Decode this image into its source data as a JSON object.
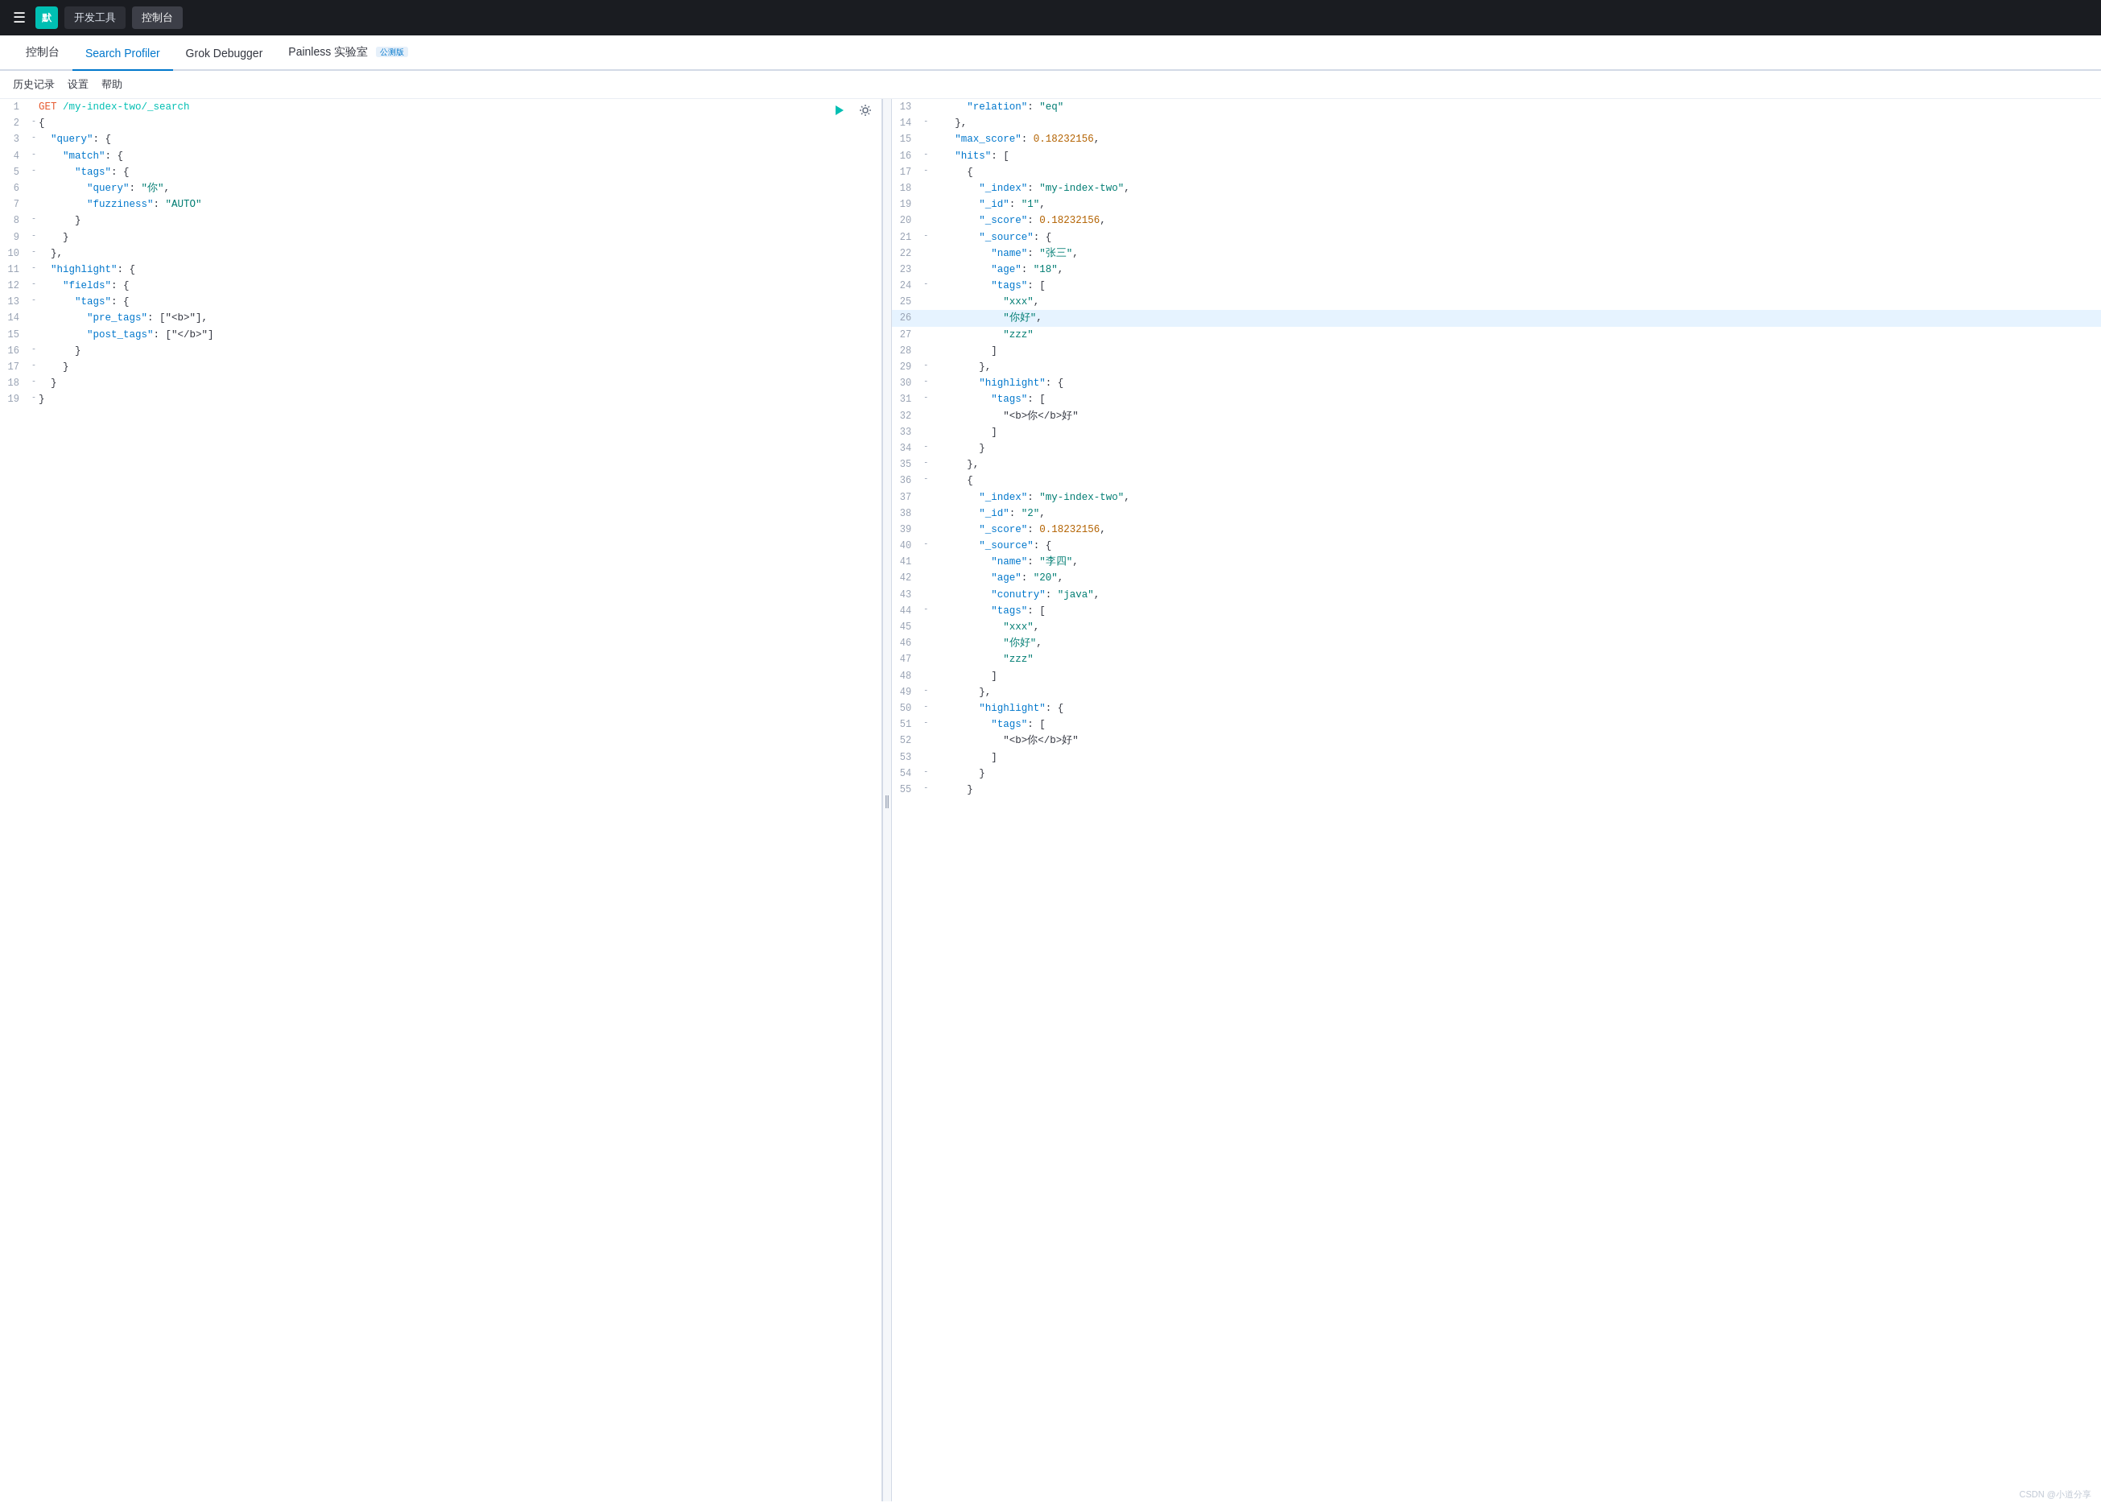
{
  "topbar": {
    "menu_icon": "☰",
    "avatar_label": "默",
    "btn_devtools": "开发工具",
    "btn_console": "控制台"
  },
  "main_nav": {
    "tabs": [
      {
        "id": "console",
        "label": "控制台",
        "active": false
      },
      {
        "id": "search-profiler",
        "label": "Search Profiler",
        "active": true
      },
      {
        "id": "grok-debugger",
        "label": "Grok Debugger",
        "active": false
      },
      {
        "id": "painless-lab",
        "label": "Painless 实验室",
        "active": false,
        "badge": "公测版"
      }
    ]
  },
  "sub_nav": {
    "items": [
      "历史记录",
      "设置",
      "帮助"
    ]
  },
  "editor": {
    "lines": [
      {
        "num": 1,
        "fold": "",
        "content": "GET /my-index-two/_search",
        "highlight": false,
        "type": "method_path"
      },
      {
        "num": 2,
        "fold": "-",
        "content": "{",
        "highlight": false
      },
      {
        "num": 3,
        "fold": "-",
        "content": "  \"query\": {",
        "highlight": false
      },
      {
        "num": 4,
        "fold": "-",
        "content": "    \"match\": {",
        "highlight": false
      },
      {
        "num": 5,
        "fold": "-",
        "content": "      \"tags\": {",
        "highlight": false
      },
      {
        "num": 6,
        "fold": "",
        "content": "        \"query\": \"你\",",
        "highlight": false
      },
      {
        "num": 7,
        "fold": "",
        "content": "        \"fuzziness\": \"AUTO\"",
        "highlight": false
      },
      {
        "num": 8,
        "fold": "-",
        "content": "      }",
        "highlight": false
      },
      {
        "num": 9,
        "fold": "-",
        "content": "    }",
        "highlight": false
      },
      {
        "num": 10,
        "fold": "-",
        "content": "  },",
        "highlight": false
      },
      {
        "num": 11,
        "fold": "-",
        "content": "  \"highlight\": {",
        "highlight": false
      },
      {
        "num": 12,
        "fold": "-",
        "content": "    \"fields\": {",
        "highlight": false
      },
      {
        "num": 13,
        "fold": "-",
        "content": "      \"tags\": {",
        "highlight": false
      },
      {
        "num": 14,
        "fold": "",
        "content": "        \"pre_tags\": [\"<b>\"],",
        "highlight": false
      },
      {
        "num": 15,
        "fold": "",
        "content": "        \"post_tags\": [\"</b>\"]",
        "highlight": false
      },
      {
        "num": 16,
        "fold": "-",
        "content": "      }",
        "highlight": false
      },
      {
        "num": 17,
        "fold": "-",
        "content": "    }",
        "highlight": false
      },
      {
        "num": 18,
        "fold": "-",
        "content": "  }",
        "highlight": false
      },
      {
        "num": 19,
        "fold": "-",
        "content": "}",
        "highlight": false
      }
    ]
  },
  "results": {
    "lines": [
      {
        "num": 13,
        "fold": "",
        "content": "      \"relation\": \"eq\"",
        "highlight": false
      },
      {
        "num": 14,
        "fold": "-",
        "content": "    },",
        "highlight": false
      },
      {
        "num": 15,
        "fold": "",
        "content": "    \"max_score\": 0.18232156,",
        "highlight": false
      },
      {
        "num": 16,
        "fold": "-",
        "content": "    \"hits\": [",
        "highlight": false
      },
      {
        "num": 17,
        "fold": "-",
        "content": "      {",
        "highlight": false
      },
      {
        "num": 18,
        "fold": "",
        "content": "        \"_index\": \"my-index-two\",",
        "highlight": false
      },
      {
        "num": 19,
        "fold": "",
        "content": "        \"_id\": \"1\",",
        "highlight": false
      },
      {
        "num": 20,
        "fold": "",
        "content": "        \"_score\": 0.18232156,",
        "highlight": false
      },
      {
        "num": 21,
        "fold": "-",
        "content": "        \"_source\": {",
        "highlight": false
      },
      {
        "num": 22,
        "fold": "",
        "content": "          \"name\": \"张三\",",
        "highlight": false
      },
      {
        "num": 23,
        "fold": "",
        "content": "          \"age\": \"18\",",
        "highlight": false
      },
      {
        "num": 24,
        "fold": "-",
        "content": "          \"tags\": [",
        "highlight": false
      },
      {
        "num": 25,
        "fold": "",
        "content": "            \"xxx\",",
        "highlight": false
      },
      {
        "num": 26,
        "fold": "",
        "content": "            \"你好\",",
        "highlight": true
      },
      {
        "num": 27,
        "fold": "",
        "content": "            \"zzz\"",
        "highlight": false
      },
      {
        "num": 28,
        "fold": "",
        "content": "          ]",
        "highlight": false
      },
      {
        "num": 29,
        "fold": "-",
        "content": "        },",
        "highlight": false
      },
      {
        "num": 30,
        "fold": "-",
        "content": "        \"highlight\": {",
        "highlight": false
      },
      {
        "num": 31,
        "fold": "-",
        "content": "          \"tags\": [",
        "highlight": false
      },
      {
        "num": 32,
        "fold": "",
        "content": "            \"<b>你</b>好\"",
        "highlight": false
      },
      {
        "num": 33,
        "fold": "",
        "content": "          ]",
        "highlight": false
      },
      {
        "num": 34,
        "fold": "-",
        "content": "        }",
        "highlight": false
      },
      {
        "num": 35,
        "fold": "-",
        "content": "      },",
        "highlight": false
      },
      {
        "num": 36,
        "fold": "-",
        "content": "      {",
        "highlight": false
      },
      {
        "num": 37,
        "fold": "",
        "content": "        \"_index\": \"my-index-two\",",
        "highlight": false
      },
      {
        "num": 38,
        "fold": "",
        "content": "        \"_id\": \"2\",",
        "highlight": false
      },
      {
        "num": 39,
        "fold": "",
        "content": "        \"_score\": 0.18232156,",
        "highlight": false
      },
      {
        "num": 40,
        "fold": "-",
        "content": "        \"_source\": {",
        "highlight": false
      },
      {
        "num": 41,
        "fold": "",
        "content": "          \"name\": \"李四\",",
        "highlight": false
      },
      {
        "num": 42,
        "fold": "",
        "content": "          \"age\": \"20\",",
        "highlight": false
      },
      {
        "num": 43,
        "fold": "",
        "content": "          \"conutry\": \"java\",",
        "highlight": false
      },
      {
        "num": 44,
        "fold": "-",
        "content": "          \"tags\": [",
        "highlight": false
      },
      {
        "num": 45,
        "fold": "",
        "content": "            \"xxx\",",
        "highlight": false
      },
      {
        "num": 46,
        "fold": "",
        "content": "            \"你好\",",
        "highlight": false
      },
      {
        "num": 47,
        "fold": "",
        "content": "            \"zzz\"",
        "highlight": false
      },
      {
        "num": 48,
        "fold": "",
        "content": "          ]",
        "highlight": false
      },
      {
        "num": 49,
        "fold": "-",
        "content": "        },",
        "highlight": false
      },
      {
        "num": 50,
        "fold": "-",
        "content": "        \"highlight\": {",
        "highlight": false
      },
      {
        "num": 51,
        "fold": "-",
        "content": "          \"tags\": [",
        "highlight": false
      },
      {
        "num": 52,
        "fold": "",
        "content": "            \"<b>你</b>好\"",
        "highlight": false
      },
      {
        "num": 53,
        "fold": "",
        "content": "          ]",
        "highlight": false
      },
      {
        "num": 54,
        "fold": "-",
        "content": "        }",
        "highlight": false
      },
      {
        "num": 55,
        "fold": "-",
        "content": "      }",
        "highlight": false
      }
    ]
  },
  "watermark": "CSDN @小道分享"
}
